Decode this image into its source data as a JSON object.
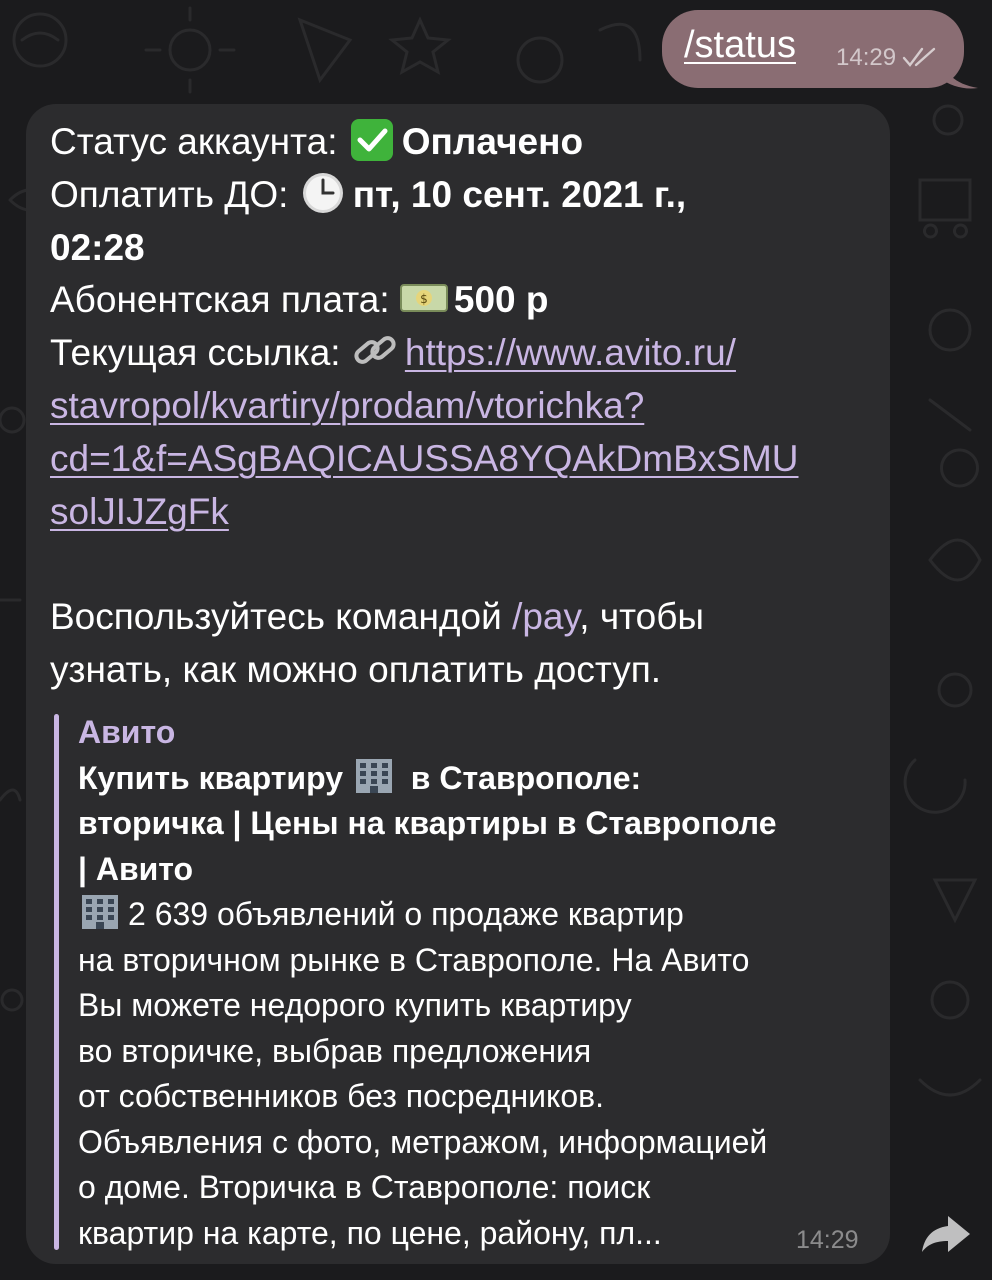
{
  "outgoing": {
    "text": "/status",
    "time": "14:29"
  },
  "incoming": {
    "status_label": "Статус аккаунта: ",
    "status_value": "Оплачено",
    "pay_until_label": "Оплатить ДО: ",
    "pay_until_value_1": "пт, 10 сент. 2021 г.,",
    "pay_until_value_2": "02:28",
    "fee_label": "Абонентская плата: ",
    "fee_value": "500 р",
    "link_label": "Текущая ссылка: ",
    "link_line_1": "https://www.avito.ru/",
    "link_line_2": "stavropol/kvartiry/prodam/vtorichka?",
    "link_line_3": "cd=1&f=ASgBAQICAUSSA8YQAkDmBxSMU",
    "link_line_4": "solJIJZgFk",
    "info_before": "Воспользуйтесь командой ",
    "info_command": "/pay",
    "info_after": ", чтобы",
    "info_line_2": "узнать, как можно оплатить доступ.",
    "time": "14:29"
  },
  "preview": {
    "site": "Авито",
    "title_line_1_a": "Купить квартиру ",
    "title_line_1_b": " в Ставрополе:",
    "title_line_2": "вторичка | Цены на квартиры в Ставрополе",
    "title_line_3": "| Авито",
    "desc_line_1": "2 639 объявлений о продаже квартир",
    "desc_line_2": "на вторичном рынке в Ставрополе. На Авито",
    "desc_line_3": "Вы можете недорого купить квартиру",
    "desc_line_4": "во вторичке, выбрав предложения",
    "desc_line_5": "от собственников без посредников.",
    "desc_line_6": "Объявления с фото, метражом, информацией",
    "desc_line_7": "о доме. Вторичка в Ставрополе: поиск",
    "desc_line_8": "квартир на карте, по цене, району, пл..."
  },
  "icons": {
    "status": "check-mark-icon",
    "pay_until": "clock-icon",
    "fee": "banknote-icon",
    "link": "link-icon",
    "building": "office-building-icon",
    "forward": "share-forward-icon",
    "read": "double-check-icon"
  },
  "colors": {
    "background": "#1b1b1d",
    "outgoing_bubble": "#8a6d73",
    "incoming_bubble": "#2c2c2e",
    "accent": "#c9b6e3",
    "check": "#3fb33b"
  }
}
